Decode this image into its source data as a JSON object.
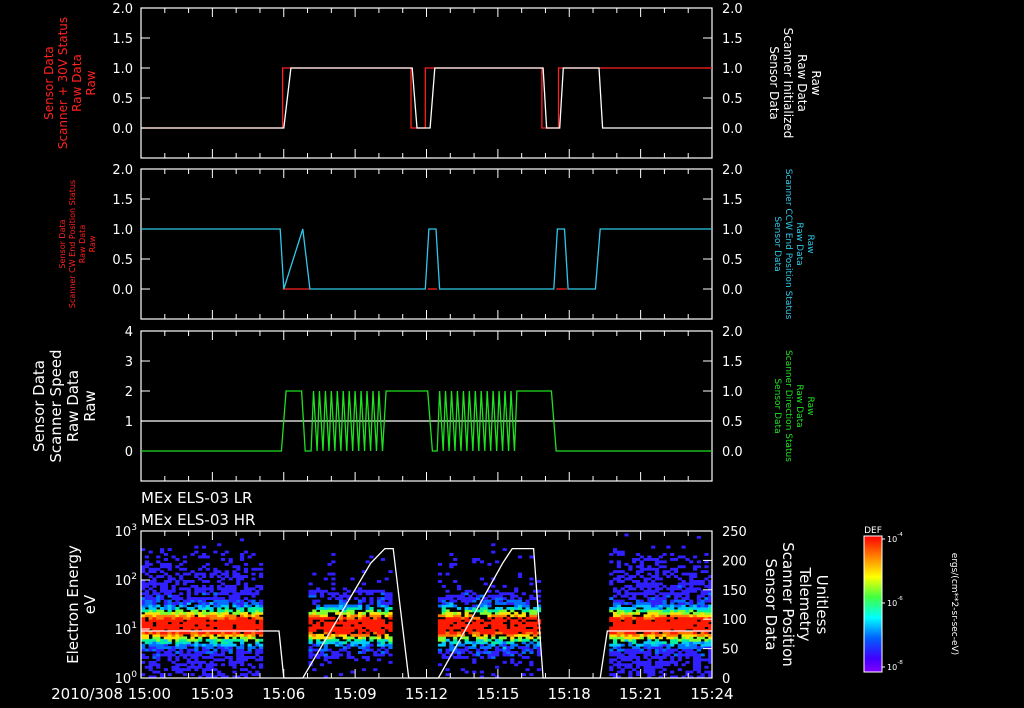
{
  "chart_data": [
    {
      "type": "line",
      "panel": "scanner-status",
      "ylabel_left": [
        "Sensor Data",
        "Scanner + 30V Status",
        "Raw Data",
        "Raw"
      ],
      "ylabel_right": [
        "Sensor Data",
        "Scanner Initialized",
        "Raw Data",
        "Raw"
      ],
      "left_color": "#ff2020",
      "right_color": "#ffffff",
      "ylim": [
        -0.5,
        2.0
      ],
      "yticks": [
        0.0,
        0.5,
        1.0,
        1.5,
        2.0
      ],
      "yticks_right": [
        0.0,
        0.5,
        1.0,
        1.5,
        2.0
      ],
      "series": [
        {
          "color": "#ff2020",
          "x": [
            0,
            5.95,
            5.95,
            11.35,
            11.35,
            11.95,
            11.95,
            16.85,
            16.85,
            17.55,
            17.55,
            24
          ],
          "y": [
            0,
            0,
            1,
            1,
            0,
            0,
            1,
            1,
            0,
            0,
            1,
            1
          ],
          "note": "last segment overlapped by white"
        },
        {
          "color": "#ffffff",
          "x": [
            0,
            6.0,
            6.3,
            11.4,
            11.6,
            12.15,
            12.35,
            16.9,
            17.05,
            17.6,
            17.75,
            19.25,
            19.4,
            24
          ],
          "y": [
            0,
            0,
            1,
            1,
            0,
            0,
            1,
            1,
            0,
            0,
            1,
            1,
            0,
            0
          ]
        }
      ]
    },
    {
      "type": "line",
      "panel": "scanner-cw",
      "ylabel_left": [
        "Sensor Data",
        "Scanner CW End Position Status",
        "Raw Data",
        "Raw"
      ],
      "ylabel_right": [
        "Sensor Data",
        "Scanner CCW End Position Status",
        "Raw Data",
        "Raw"
      ],
      "left_color": "#ff2020",
      "right_color": "#30c8e8",
      "ylim": [
        -0.5,
        2.0
      ],
      "yticks": [
        0.0,
        0.5,
        1.0,
        1.5,
        2.0
      ],
      "yticks_right": [
        0.0,
        0.5,
        1.0,
        1.5,
        2.0
      ],
      "series": [
        {
          "color": "#ff2020",
          "x": [
            5.95,
            7.1
          ],
          "y": [
            0,
            0
          ]
        },
        {
          "color": "#ff2020",
          "x": [
            12.05,
            12.45
          ],
          "y": [
            0,
            0
          ]
        },
        {
          "color": "#ff2020",
          "x": [
            17.45,
            17.9
          ],
          "y": [
            0,
            0
          ]
        },
        {
          "color": "#30c8e8",
          "x": [
            0,
            5.85,
            6.0,
            6.8,
            7.1,
            11.95,
            12.1,
            12.4,
            12.55,
            17.35,
            17.5,
            17.8,
            17.95,
            19.1,
            19.3,
            24
          ],
          "y": [
            1,
            1,
            0,
            1,
            0,
            0,
            1,
            1,
            0,
            0,
            1,
            1,
            0,
            0,
            1,
            1
          ]
        }
      ]
    },
    {
      "type": "line",
      "panel": "scanner-speed",
      "ylabel_left": [
        "Sensor Data",
        "Scanner Speed",
        "Raw Data",
        "Raw"
      ],
      "ylabel_right": [
        "Sensor Data",
        "Scanner Direction Status",
        "Raw Data",
        "Raw"
      ],
      "left_color": "#ffffff",
      "right_color": "#20e020",
      "ylim": [
        -1,
        4
      ],
      "yticks": [
        0,
        1,
        2,
        3,
        4
      ],
      "yticks_right": [
        0.0,
        0.5,
        1.0,
        1.5,
        2.0
      ],
      "series": [
        {
          "color": "#ffffff",
          "x": [
            0,
            24
          ],
          "y": [
            1,
            1
          ]
        },
        {
          "color": "#20e020",
          "x": [
            0,
            5.9,
            6.1,
            6.75,
            6.9,
            7.15,
            7.25,
            7.4,
            7.5,
            7.65,
            7.75,
            7.9,
            8.0,
            8.15,
            8.25,
            8.4,
            8.5,
            8.65,
            8.75,
            8.9,
            9.0,
            9.15,
            9.25,
            9.4,
            9.5,
            9.65,
            9.75,
            9.9,
            10.0,
            10.15,
            10.3,
            12.05,
            12.25,
            12.45,
            12.55,
            12.7,
            12.8,
            12.95,
            13.05,
            13.2,
            13.3,
            13.45,
            13.55,
            13.7,
            13.8,
            13.95,
            14.05,
            14.2,
            14.3,
            14.45,
            14.55,
            14.7,
            14.8,
            14.95,
            15.05,
            15.2,
            15.3,
            15.45,
            15.55,
            15.7,
            15.8,
            17.25,
            17.45,
            24
          ],
          "y": [
            0,
            0,
            2,
            2,
            0,
            0,
            2,
            0,
            2,
            0,
            2,
            0,
            2,
            0,
            2,
            0,
            2,
            0,
            2,
            0,
            2,
            0,
            2,
            0,
            2,
            0,
            2,
            0,
            2,
            0,
            2,
            2,
            0,
            0,
            2,
            0,
            2,
            0,
            2,
            0,
            2,
            0,
            2,
            0,
            2,
            0,
            2,
            0,
            2,
            0,
            2,
            0,
            2,
            0,
            2,
            0,
            2,
            0,
            2,
            0,
            2,
            2,
            0,
            0
          ]
        }
      ]
    },
    {
      "type": "heatmap",
      "panel": "els-spectrogram",
      "title_lines": [
        "MEx ELS-03 LR",
        "MEx ELS-03 HR"
      ],
      "ylabel_left": [
        "Electron Energy",
        "eV"
      ],
      "ylabel_right": [
        "Sensor Data",
        "Scanner Position",
        "Telemetry",
        "Unitless"
      ],
      "yscale": "log",
      "ylim": [
        1,
        1000
      ],
      "yticks_left": [
        {
          "base": "10",
          "exp": "0"
        },
        {
          "base": "10",
          "exp": "1"
        },
        {
          "base": "10",
          "exp": "2"
        },
        {
          "base": "10",
          "exp": "3"
        }
      ],
      "ylim_right": [
        0,
        250
      ],
      "yticks_right": [
        0,
        50,
        100,
        150,
        200,
        250
      ],
      "data_gaps_minutes": [
        [
          5.1,
          7.0
        ],
        [
          10.5,
          12.45
        ],
        [
          16.8,
          19.75
        ]
      ],
      "peak_energy_ev": 12,
      "position_color": "#ffffff",
      "position_series": {
        "x": [
          0,
          4.8,
          5.8,
          6.0,
          6.8,
          9.65,
          10.25,
          10.6,
          11.25,
          12.5,
          15.2,
          15.6,
          16.5,
          16.9,
          19.3,
          19.6,
          24
        ],
        "y": [
          80,
          80,
          80,
          0,
          0,
          195,
          220,
          220,
          0,
          0,
          195,
          220,
          220,
          0,
          0,
          80,
          80
        ]
      },
      "colorbar": {
        "title": "DEF",
        "tick_labels": [
          {
            "base": "10",
            "exp": "-4"
          },
          {
            "base": "10",
            "exp": "-6"
          },
          {
            "base": "10",
            "exp": "-8"
          }
        ],
        "units": "ergs/(cm**2-sr-sec-eV)"
      }
    }
  ],
  "x_axis": {
    "unit": "minutes after 15:00",
    "xlim": [
      0,
      24
    ],
    "ticks": [
      {
        "x": 0,
        "label": "2010/308 15:00"
      },
      {
        "x": 3,
        "label": "15:03"
      },
      {
        "x": 6,
        "label": "15:06"
      },
      {
        "x": 9,
        "label": "15:09"
      },
      {
        "x": 12,
        "label": "15:12"
      },
      {
        "x": 15,
        "label": "15:15"
      },
      {
        "x": 18,
        "label": "15:18"
      },
      {
        "x": 21,
        "label": "15:21"
      },
      {
        "x": 24,
        "label": "15:24"
      }
    ]
  }
}
